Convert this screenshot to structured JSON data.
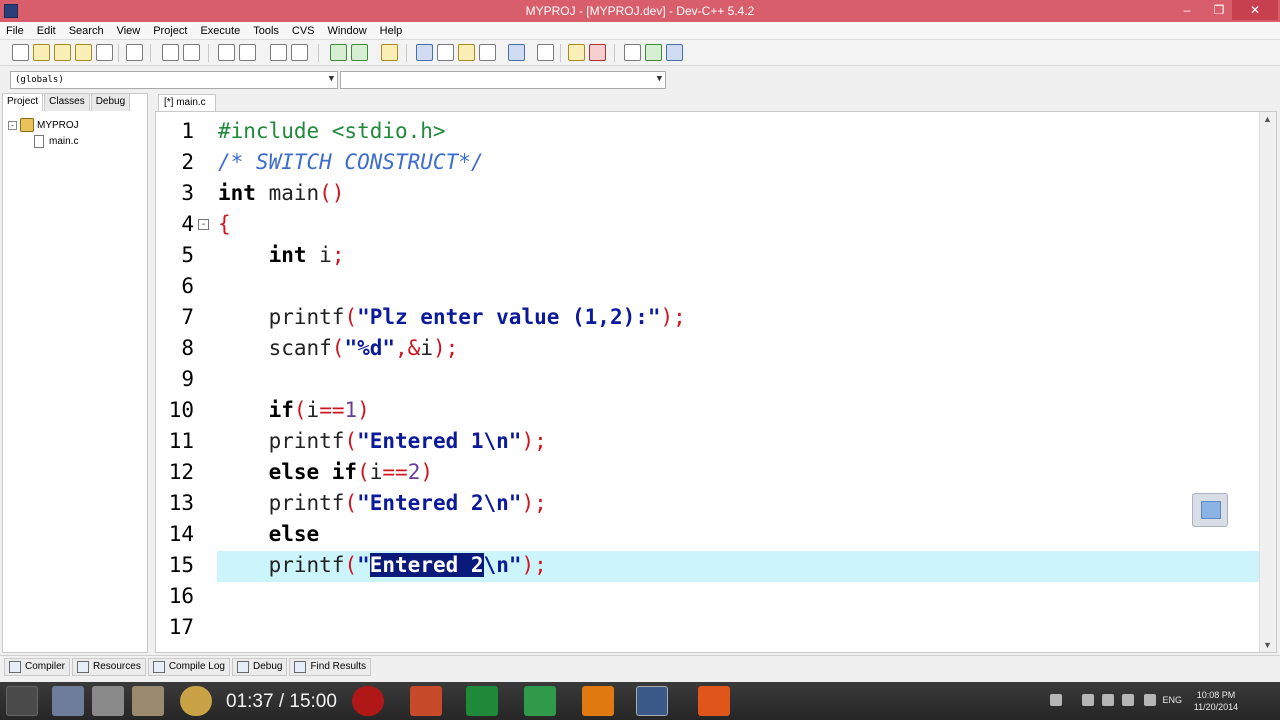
{
  "window": {
    "title": "MYPROJ - [MYPROJ.dev] - Dev-C++ 5.4.2"
  },
  "menu": [
    "File",
    "Edit",
    "Search",
    "View",
    "Project",
    "Execute",
    "Tools",
    "CVS",
    "Window",
    "Help"
  ],
  "scope": {
    "class_combo": "(globals)",
    "member_combo": ""
  },
  "panel_tabs": [
    "Project",
    "Classes",
    "Debug"
  ],
  "project_tree": {
    "project": "MYPROJ",
    "file": "main.c"
  },
  "editor": {
    "tab_label": "[*] main.c",
    "current_line": 15,
    "lines": [
      {
        "num": "1",
        "text": "#include <stdio.h>"
      },
      {
        "num": "2",
        "text": "/* SWITCH CONSTRUCT*/"
      },
      {
        "num": "3",
        "text": "int main()"
      },
      {
        "num": "4",
        "text": "{"
      },
      {
        "num": "5",
        "text": "    int i;"
      },
      {
        "num": "6",
        "text": ""
      },
      {
        "num": "7",
        "text": "    printf(\"Plz enter value (1,2):\");"
      },
      {
        "num": "8",
        "text": "    scanf(\"%d\",&i);"
      },
      {
        "num": "9",
        "text": ""
      },
      {
        "num": "10",
        "text": "    if(i==1)"
      },
      {
        "num": "11",
        "text": "    printf(\"Entered 1\\n\");"
      },
      {
        "num": "12",
        "text": "    else if(i==2)"
      },
      {
        "num": "13",
        "text": "    printf(\"Entered 2\\n\");"
      },
      {
        "num": "14",
        "text": "    else"
      },
      {
        "num": "15",
        "text": "    printf(\"Entered 2\\n\");"
      },
      {
        "num": "16",
        "text": ""
      },
      {
        "num": "17",
        "text": ""
      }
    ],
    "selected_text": "Entered 2"
  },
  "bottom_tabs": [
    "Compiler",
    "Resources",
    "Compile Log",
    "Debug",
    "Find Results"
  ],
  "taskbar": {
    "video_time": "01:37 / 15:00",
    "lang": "ENG",
    "clock_time": "10:08 PM",
    "clock_date": "11/20/2014"
  },
  "colors": {
    "titlebar": "#d95e6c",
    "keyword": "#000000",
    "preprocessor": "#1e8a3a",
    "comment": "#3d6ccf",
    "string": "#0a1a9a",
    "punctuation": "#d0141f",
    "current_line": "#ccf5fb",
    "selection": "#0a1a7a"
  }
}
